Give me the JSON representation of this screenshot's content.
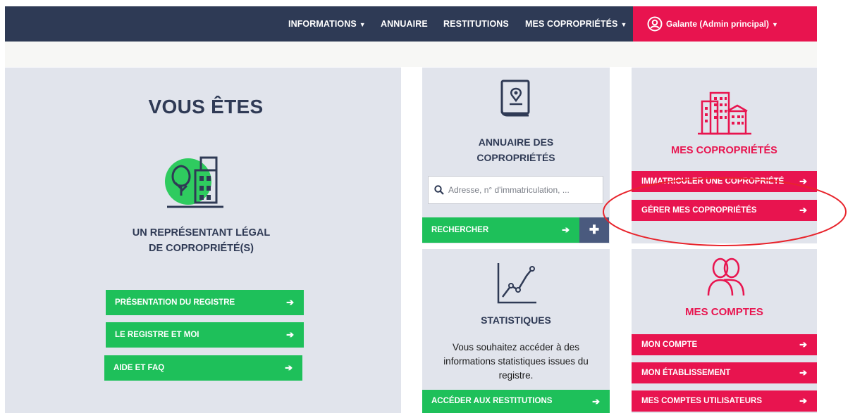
{
  "colors": {
    "navy": "#2e3a55",
    "pink": "#e8144f",
    "green": "#1ec05a",
    "panel": "#e1e4ec"
  },
  "nav": {
    "informations": "INFORMATIONS",
    "annuaire": "ANNUAIRE",
    "restitutions": "RESTITUTIONS",
    "mes_coproprietes": "MES COPROPRIÉTÉS",
    "user": "Galante (Admin principal)"
  },
  "left": {
    "title": "VOUS ÊTES",
    "role_line1": "UN REPRÉSENTANT LÉGAL",
    "role_line2": "DE COPROPRIÉTÉ(S)",
    "buttons": [
      "PRÉSENTATION DU REGISTRE",
      "LE REGISTRE ET MOI",
      "AIDE ET FAQ"
    ],
    "icon": "tree-building-icon"
  },
  "annuaire": {
    "title_line1": "ANNUAIRE DES",
    "title_line2": "COPROPRIÉTÉS",
    "search_placeholder": "Adresse, n° d'immatriculation, ...",
    "search_button": "RECHERCHER",
    "icon": "address-book-icon"
  },
  "stats": {
    "title": "STATISTIQUES",
    "text_line1": "Vous souhaitez accéder à des",
    "text_line2": "informations statistiques issues du",
    "text_line3": "registre.",
    "button": "ACCÉDER AUX RESTITUTIONS",
    "icon": "line-chart-icon"
  },
  "mes_coproprietes": {
    "title": "MES COPROPRIÉTÉS",
    "buttons": [
      "IMMATRICULER UNE COPROPRIÉTÉ",
      "GÉRER MES COPROPRIÉTÉS"
    ],
    "icon": "buildings-icon"
  },
  "mes_comptes": {
    "title": "MES COMPTES",
    "buttons": [
      "MON COMPTE",
      "MON ÉTABLISSEMENT",
      "MES COMPTES UTILISATEURS"
    ],
    "icon": "users-icon"
  }
}
